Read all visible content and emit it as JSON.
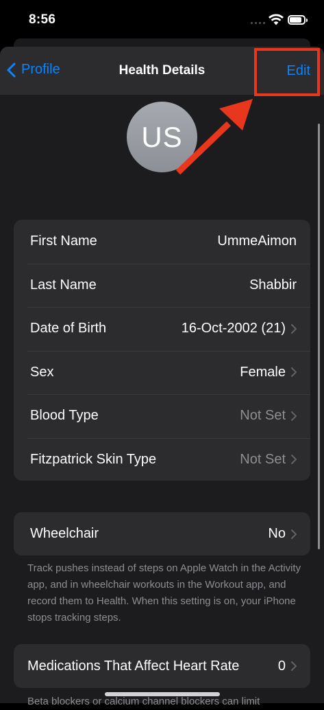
{
  "status_bar": {
    "time": "8:56"
  },
  "nav": {
    "back_label": "Profile",
    "title": "Health Details",
    "edit_label": "Edit"
  },
  "avatar": {
    "initials": "US"
  },
  "details": [
    {
      "label": "First Name",
      "value": "UmmeAimon"
    },
    {
      "label": "Last Name",
      "value": "Shabbir"
    },
    {
      "label": "Date of Birth",
      "value": "16-Oct-2002 (21)"
    },
    {
      "label": "Sex",
      "value": "Female"
    },
    {
      "label": "Blood Type",
      "value": "Not Set"
    },
    {
      "label": "Fitzpatrick Skin Type",
      "value": "Not Set"
    }
  ],
  "wheelchair": {
    "label": "Wheelchair",
    "value": "No",
    "footnote": "Track pushes instead of steps on Apple Watch in the Activity app, and in wheelchair workouts in the Workout app, and record them to Health. When this setting is on, your iPhone stops tracking steps."
  },
  "medications": {
    "label": "Medications That Affect Heart Rate",
    "value": "0",
    "footnote": "Beta blockers or calcium channel blockers can limit"
  },
  "colors": {
    "accent": "#0a84ff",
    "annotation": "#e8371c",
    "background": "#1c1c1e",
    "cell": "#2c2c2e"
  },
  "icons": {
    "back": "chevron-left-icon",
    "disclosure": "chevron-right-icon",
    "wifi": "wifi-icon",
    "battery": "battery-icon"
  }
}
